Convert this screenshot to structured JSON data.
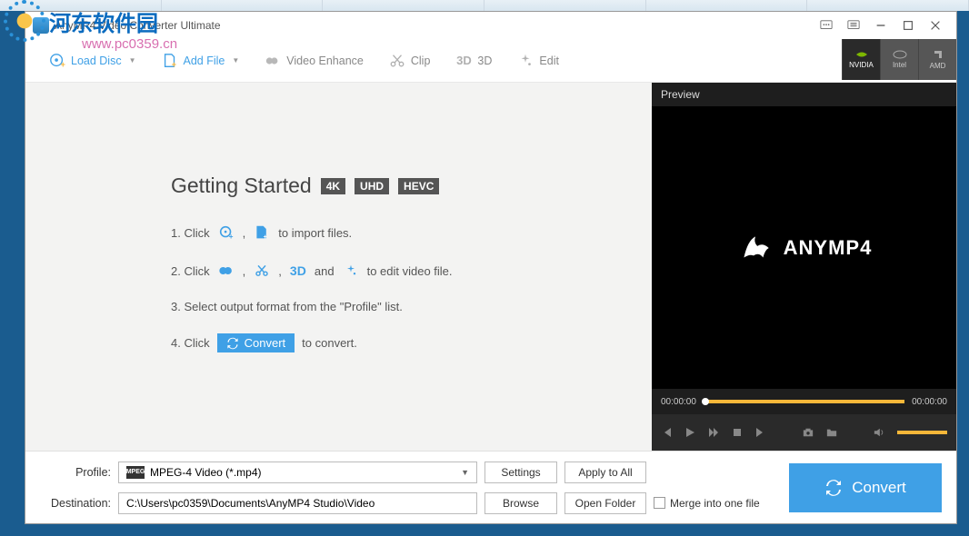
{
  "app": {
    "title": "AnyMP4 Video Converter Ultimate"
  },
  "toolbar": {
    "loadDisc": "Load Disc",
    "addFile": "Add File",
    "videoEnhance": "Video Enhance",
    "clip": "Clip",
    "threeD": "3D",
    "edit": "Edit"
  },
  "gpu": {
    "nvidia": "NVIDIA",
    "intel": "Intel",
    "amd": "AMD"
  },
  "gs": {
    "title": "Getting Started",
    "tags": [
      "4K",
      "UHD",
      "HEVC"
    ],
    "step1a": "1. Click",
    "step1b": ",",
    "step1c": "to import files.",
    "step2a": "2. Click",
    "step2b": ",",
    "step2c": ",",
    "step2d": "and",
    "step2e": "to edit video file.",
    "step3": "3. Select output format from the \"Profile\" list.",
    "step4a": "4. Click",
    "step4btn": "Convert",
    "step4b": "to convert."
  },
  "preview": {
    "label": "Preview",
    "brand": "ANYMP4",
    "timeStart": "00:00:00",
    "timeEnd": "00:00:00"
  },
  "footer": {
    "profileLabel": "Profile:",
    "profileValue": "MPEG-4 Video (*.mp4)",
    "profileIconText": "MPEG",
    "destLabel": "Destination:",
    "destValue": "C:\\Users\\pc0359\\Documents\\AnyMP4 Studio\\Video",
    "settings": "Settings",
    "applyAll": "Apply to All",
    "browse": "Browse",
    "openFolder": "Open Folder",
    "merge": "Merge into one file",
    "convert": "Convert"
  },
  "watermark": {
    "text1": "河东软件园",
    "text2": "www.pc0359.cn"
  }
}
